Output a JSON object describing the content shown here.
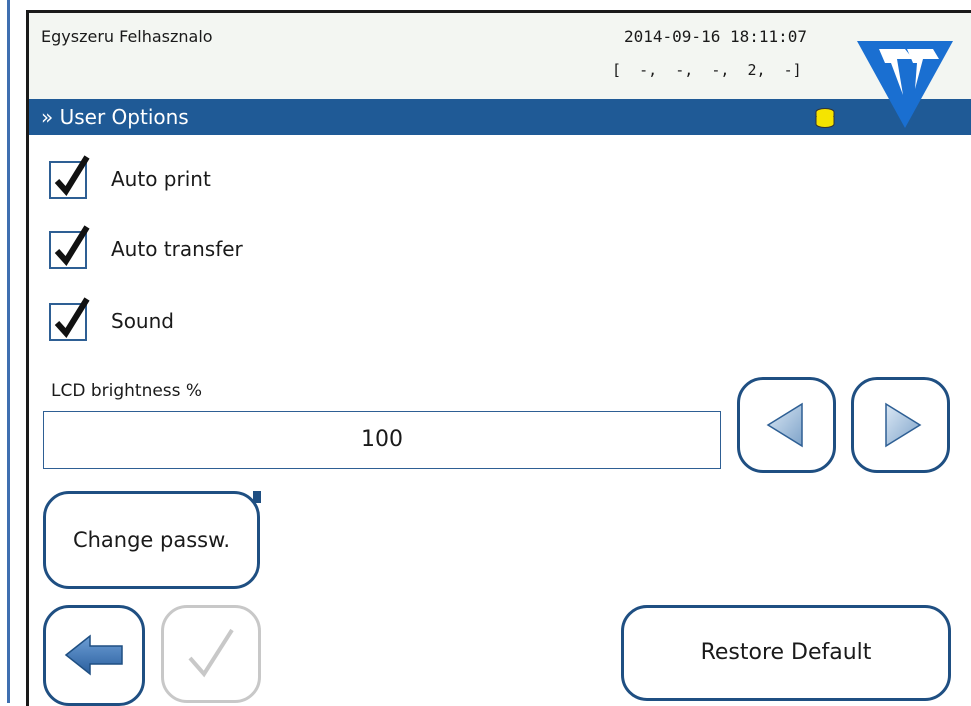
{
  "header": {
    "user_name": "Egyszeru Felhasznalo",
    "datetime": "2014-09-16 18:11:07",
    "status_codes": "[  -,  -,  -,  2,  -]"
  },
  "titlebar": {
    "title": "» User Options"
  },
  "options": [
    {
      "label": "Auto print",
      "checked": true
    },
    {
      "label": "Auto transfer",
      "checked": true
    },
    {
      "label": "Sound",
      "checked": true
    }
  ],
  "brightness": {
    "label": "LCD brightness %",
    "value": "100"
  },
  "buttons": {
    "change_password": "Change passw.",
    "restore_default": "Restore Default",
    "decrease_icon": "triangle-left-icon",
    "increase_icon": "triangle-right-icon",
    "back_icon": "arrow-left-icon",
    "confirm_icon": "checkmark-icon"
  },
  "colors": {
    "title_bar": "#1f5a96",
    "button_border": "#1f4f82",
    "checkbox_border": "#2e5f94",
    "db_icon": "#f5e400",
    "disabled": "#c8c8c8"
  }
}
